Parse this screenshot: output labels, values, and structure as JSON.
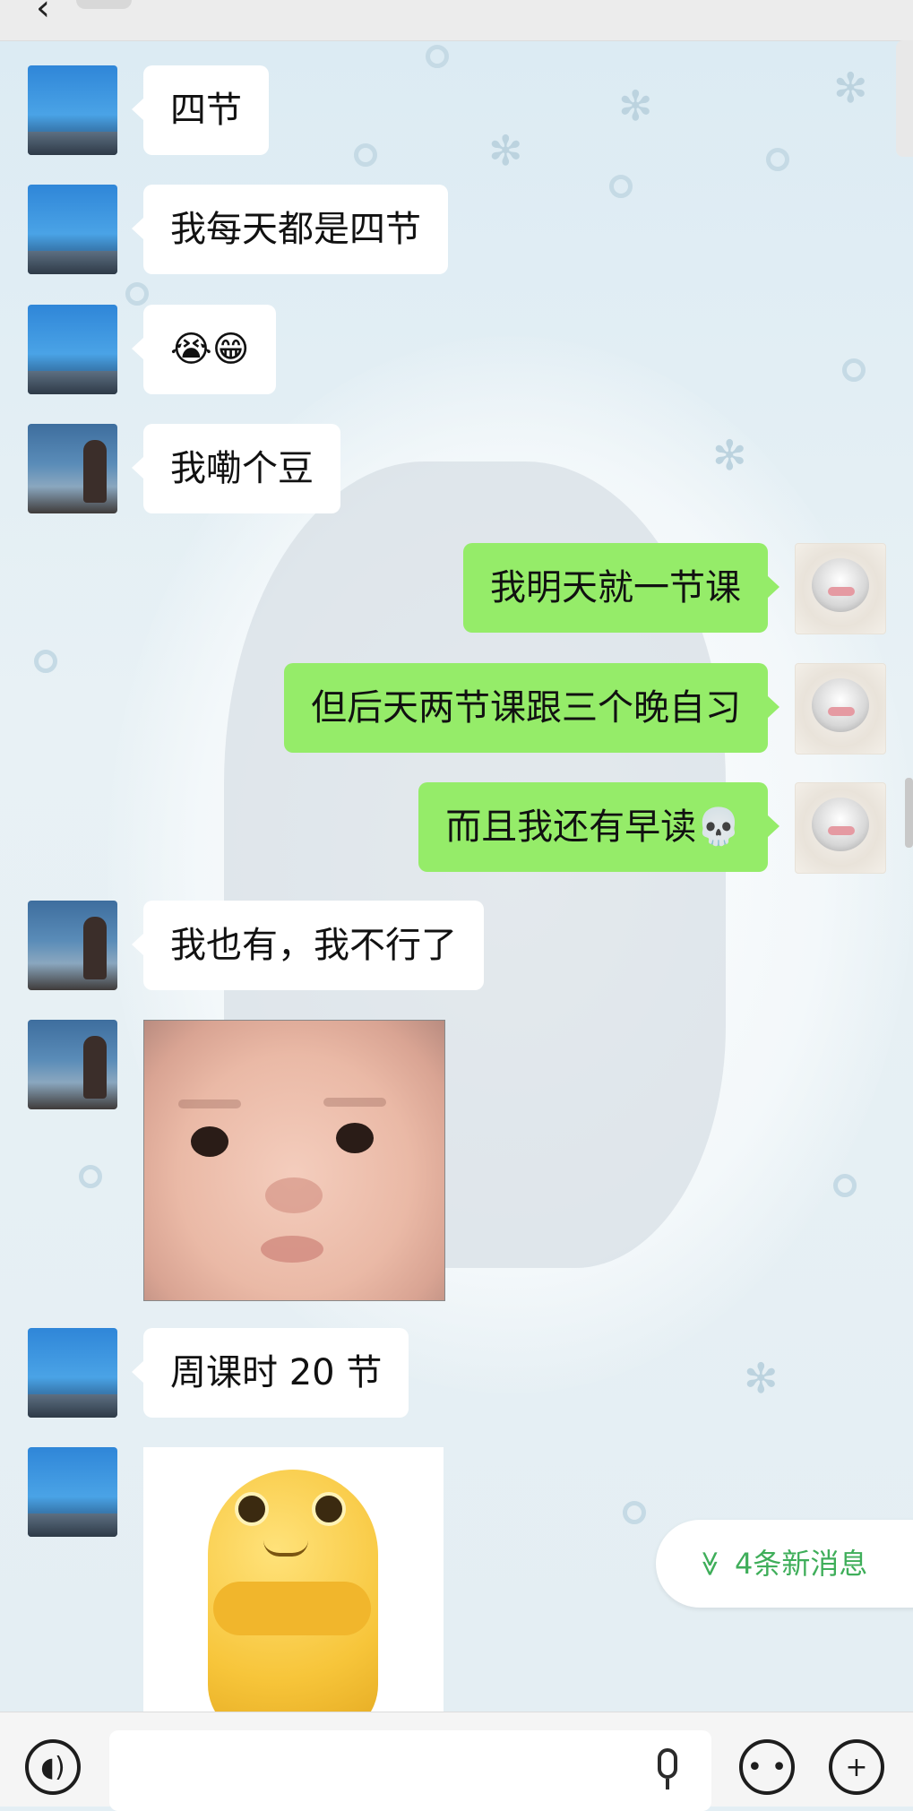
{
  "header": {
    "back": "‹",
    "title": ""
  },
  "messages": [
    {
      "side": "left",
      "avatar": "sea",
      "text": "四节"
    },
    {
      "side": "left",
      "avatar": "sea",
      "text": "我每天都是四节"
    },
    {
      "side": "left",
      "avatar": "sea",
      "text": "😭😁"
    },
    {
      "side": "left",
      "avatar": "birds",
      "text": "我嘞个豆"
    },
    {
      "side": "right",
      "avatar": "anime",
      "text": "我明天就一节课"
    },
    {
      "side": "right",
      "avatar": "anime",
      "text": "但后天两节课跟三个晚自习"
    },
    {
      "side": "right",
      "avatar": "anime",
      "text": "而且我还有早读💀"
    },
    {
      "side": "left",
      "avatar": "birds",
      "text": "我也有，我不行了"
    },
    {
      "side": "left",
      "avatar": "birds",
      "image": "baby-face-sticker"
    },
    {
      "side": "left",
      "avatar": "sea",
      "text": "周课时 20 节"
    },
    {
      "side": "left",
      "avatar": "sea",
      "image": "yellow-toy-sticker"
    }
  ],
  "new_messages": {
    "chevron": "≫",
    "label": "4条新消息"
  },
  "footer": {
    "voice_icon": "voice-icon",
    "mic_icon": "mic-icon",
    "emoji_icon": "emoji-icon",
    "plus_icon": "plus-icon"
  },
  "colors": {
    "own_bubble": "#95ec69",
    "other_bubble": "#ffffff",
    "new_msg_text": "#3fae5a"
  }
}
